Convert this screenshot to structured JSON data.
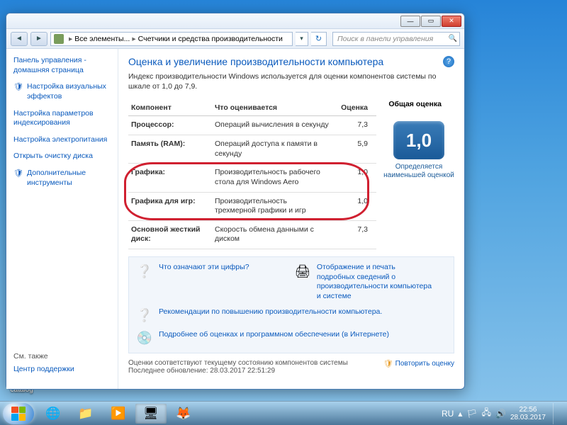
{
  "breadcrumb": {
    "part1": "Все элементы...",
    "part2": "Счетчики и средства производительности"
  },
  "search": {
    "placeholder": "Поиск в панели управления"
  },
  "sidebar": {
    "home": "Панель управления - домашняя страница",
    "visual": "Настройка визуальных эффектов",
    "indexing": "Настройка параметров индексирования",
    "power": "Настройка электропитания",
    "diskclean": "Открыть очистку диска",
    "tools": "Дополнительные инструменты",
    "seealso": "См. также",
    "support": "Центр поддержки"
  },
  "main": {
    "title": "Оценка и увеличение производительности компьютера",
    "desc": "Индекс производительности Windows используется для оценки компонентов системы по шкале от 1,0 до 7,9.",
    "headers": {
      "component": "Компонент",
      "what": "Что оценивается",
      "score": "Оценка",
      "overall": "Общая оценка"
    },
    "rows": [
      {
        "comp": "Процессор:",
        "what": "Операций вычисления в секунду",
        "score": "7,3"
      },
      {
        "comp": "Память (RAM):",
        "what": "Операций доступа к памяти в секунду",
        "score": "5,9"
      },
      {
        "comp": "Графика:",
        "what": "Производительность рабочего стола для Windows Aero",
        "score": "1,0"
      },
      {
        "comp": "Графика для игр:",
        "what": "Производительность трехмерной графики и игр",
        "score": "1,0"
      },
      {
        "comp": "Основной жесткий диск:",
        "what": "Скорость обмена данными с диском",
        "score": "7,3"
      }
    ],
    "overall_score": "1,0",
    "overall_caption": "Определяется наименьшей оценкой"
  },
  "links": {
    "whatnumbers": "Что означают эти цифры?",
    "printinfo": "Отображение и печать подробных сведений о производительности компьютера и системе",
    "recommend": "Рекомендации по повышению производительности компьютера.",
    "learnmore": "Подробнее об оценках и программном обеспечении (в Интернете)"
  },
  "footer": {
    "status": "Оценки соответствуют текущему состоянию компонентов системы",
    "lastupdate": "Последнее обновление: 28.03.2017 22:51:29",
    "repeat": "Повторить оценку"
  },
  "desktop": {
    "catalog": "catalog"
  },
  "tray": {
    "lang": "RU",
    "time": "22:56",
    "date": "28.03.2017"
  }
}
